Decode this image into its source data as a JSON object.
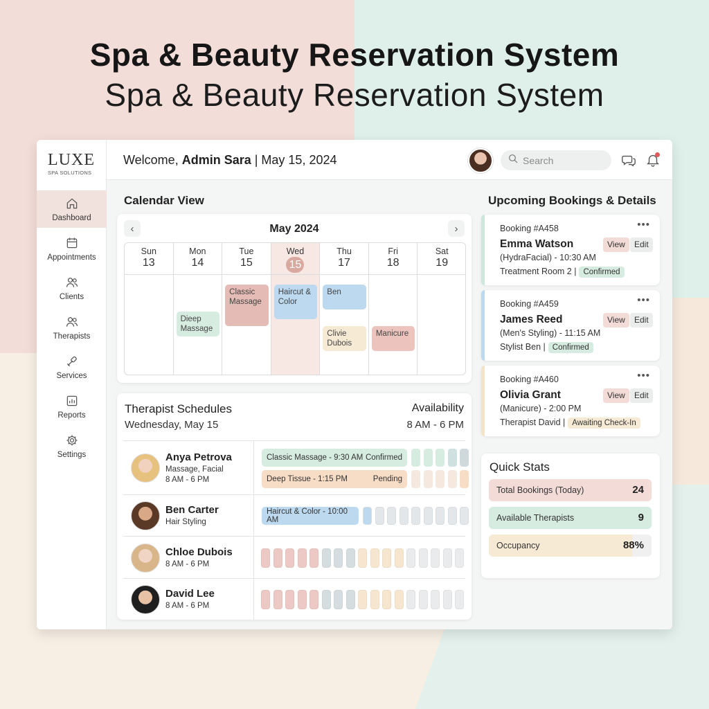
{
  "headline": {
    "bold": "Spa & Beauty Reservation System",
    "regular": "Spa & Beauty Reservation  System"
  },
  "brand": {
    "name": "LUXE",
    "tagline": "SPA SOLUTIONS"
  },
  "nav": [
    {
      "label": "Dashboard",
      "icon": "home-icon",
      "active": true
    },
    {
      "label": "Appointments",
      "icon": "calendar-icon",
      "active": false
    },
    {
      "label": "Clients",
      "icon": "users-icon",
      "active": false
    },
    {
      "label": "Therapists",
      "icon": "therapist-icon",
      "active": false
    },
    {
      "label": "Services",
      "icon": "tools-icon",
      "active": false
    },
    {
      "label": "Reports",
      "icon": "chart-icon",
      "active": false
    },
    {
      "label": "Settings",
      "icon": "gear-icon",
      "active": false
    }
  ],
  "topbar": {
    "welcome_prefix": "Welcome, ",
    "user": "Admin Sara",
    "date_text": " | May 15, 2024",
    "search_placeholder": "Search"
  },
  "calendar": {
    "title": "Calendar View",
    "month": "May 2024",
    "prev": "‹",
    "next": "›",
    "days": [
      {
        "name": "Sun",
        "num": "13",
        "today": false
      },
      {
        "name": "Mon",
        "num": "14",
        "today": false
      },
      {
        "name": "Tue",
        "num": "15",
        "today": false
      },
      {
        "name": "Wed",
        "num": "15",
        "today": true
      },
      {
        "name": "Thu",
        "num": "17",
        "today": false
      },
      {
        "name": "Fri",
        "num": "18",
        "today": false
      },
      {
        "name": "Sat",
        "num": "19",
        "today": false
      }
    ],
    "events": [
      {
        "day": 1,
        "text": "Dieep\nMassage",
        "color": "#d7ece1"
      },
      {
        "day": 2,
        "text": "Classic\nMassage",
        "color": "#e5bcb5"
      },
      {
        "day": 3,
        "text": "Haircut &\nColor",
        "color": "#bcd9ef"
      },
      {
        "day": 4,
        "text": "Ben",
        "color": "#bcd9ef"
      },
      {
        "day": 4,
        "text": "Clivie\nDubois",
        "color": "#f6ead5"
      },
      {
        "day": 5,
        "text": "Manicure",
        "color": "#edc4bd"
      }
    ]
  },
  "schedules": {
    "title": "Therapist Schedules",
    "date": "Wednesday, May 15",
    "availability_label": "Availability",
    "availability_hours": "8 AM - 6 PM",
    "therapists": [
      {
        "name": "Anya Petrova",
        "specialty": "Massage, Facial",
        "hours": "8 AM - 6 PM",
        "appointments": [
          {
            "text": "Classic Massage - 9:30 AM",
            "status": "Confirmed",
            "color": "#d7ece1"
          },
          {
            "text": "Deep Tissue - 1:15 PM",
            "status": "Pending",
            "color": "#f7dcc6"
          }
        ]
      },
      {
        "name": "Ben Carter",
        "specialty": "Hair Styling",
        "hours": "",
        "appointments": [
          {
            "text": "Haircut & Color - 10:00 AM",
            "status": "",
            "color": "#bcd9ef"
          }
        ]
      },
      {
        "name": "Chloe Dubois",
        "specialty": "",
        "hours": "8 AM - 6 PM",
        "appointments": []
      },
      {
        "name": "David Lee",
        "specialty": "",
        "hours": "8 AM - 6 PM",
        "appointments": []
      }
    ]
  },
  "bookings": {
    "title": "Upcoming Bookings & Details",
    "view_label": "View",
    "edit_label": "Edit",
    "more": "•••",
    "items": [
      {
        "id": "Booking #A458",
        "name": "Emma Watson",
        "service": "(HydraFacial) - 10:30 AM",
        "location": "Treatment Room 2 |",
        "status": "Confirmed",
        "stripe": "#cfe6dc",
        "badge_bg": "#d7ece1"
      },
      {
        "id": "Booking #A459",
        "name": "James Reed",
        "service": "(Men's Styling) - 11:15 AM",
        "location": "Stylist Ben |",
        "status": "Confirmed",
        "stripe": "#bcd9ef",
        "badge_bg": "#d7ece1"
      },
      {
        "id": "Booking #A460",
        "name": "Olivia Grant",
        "service": "(Manicure) - 2:00 PM",
        "location": "Therapist David |",
        "status": "Awaiting Check-In",
        "stripe": "#f3e3c9",
        "badge_bg": "#f6ead5"
      }
    ]
  },
  "stats": {
    "title": "Quick Stats",
    "items": [
      {
        "label": "Total Bookings (Today)",
        "value": "24",
        "fill": 1.0,
        "color": "#f3dcd8"
      },
      {
        "label": "Available Therapists",
        "value": "9",
        "fill": 1.0,
        "color": "#d7ece1"
      },
      {
        "label": "Occupancy",
        "value": "88%",
        "fill": 0.88,
        "color": "#f6ead5"
      }
    ]
  }
}
